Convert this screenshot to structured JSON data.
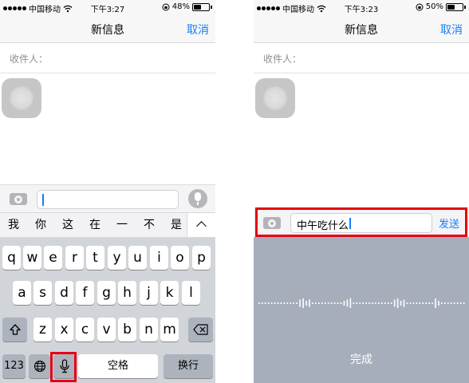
{
  "left": {
    "status": {
      "carrier": "中国移动",
      "time": "下午3:27",
      "battery": "48%",
      "battery_level": 0.48
    },
    "nav": {
      "title": "新信息",
      "cancel": "取消"
    },
    "recipient_label": "收件人：",
    "candidates": [
      "我",
      "你",
      "这",
      "在",
      "一",
      "不",
      "是"
    ],
    "keyboard": {
      "row1": [
        "q",
        "w",
        "e",
        "r",
        "t",
        "y",
        "u",
        "i",
        "o",
        "p"
      ],
      "row2": [
        "a",
        "s",
        "d",
        "f",
        "g",
        "h",
        "j",
        "k",
        "l"
      ],
      "row3": [
        "z",
        "x",
        "c",
        "v",
        "b",
        "n",
        "m"
      ],
      "numbers": "123",
      "space": "空格",
      "return": "换行"
    }
  },
  "right": {
    "status": {
      "carrier": "中国移动",
      "time": "下午3:23",
      "battery": "50%",
      "battery_level": 0.5
    },
    "nav": {
      "title": "新信息",
      "cancel": "取消"
    },
    "recipient_label": "收件人：",
    "message_text": "中午吃什么",
    "send": "发送",
    "done": "完成"
  },
  "colors": {
    "accent": "#157efb",
    "highlight": "#e60012",
    "keyboard_bg": "#d1d4d9",
    "voice_bg": "#a7aebb"
  },
  "icons": [
    "signal-dots-icon",
    "wifi-icon",
    "orientation-lock-icon",
    "battery-icon",
    "camera-icon",
    "microphone-icon",
    "globe-icon",
    "shift-icon",
    "delete-icon",
    "chevron-up-icon"
  ]
}
